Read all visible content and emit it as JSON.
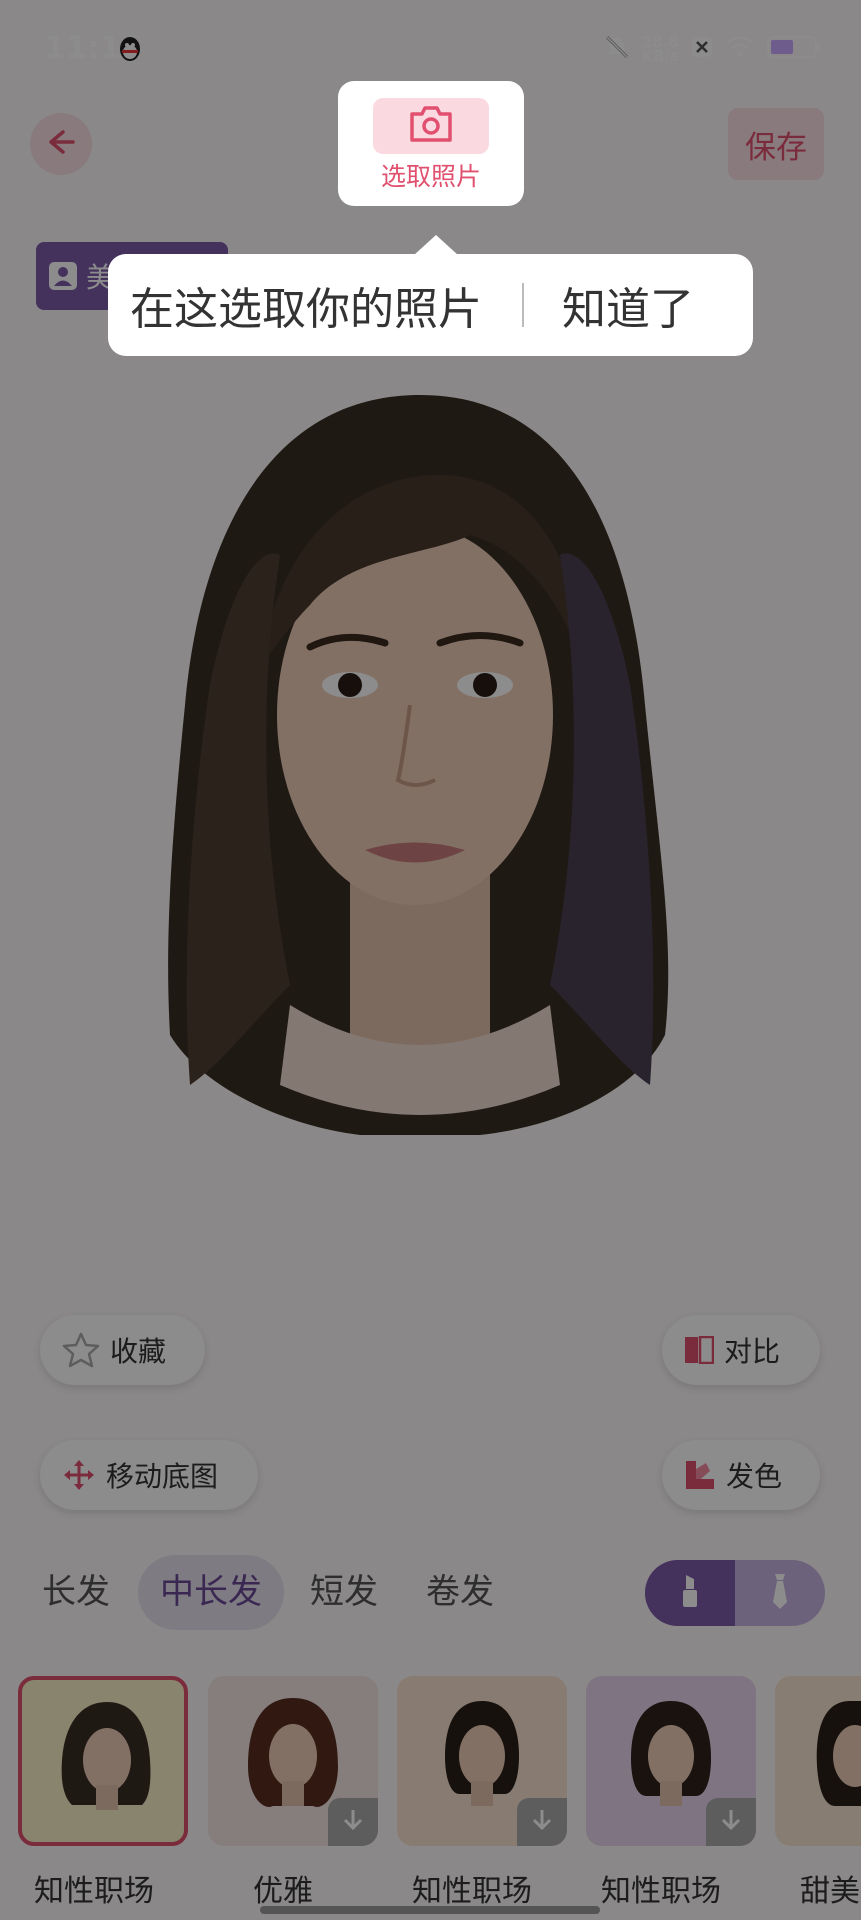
{
  "status_bar": {
    "time": "11:11",
    "net_speed_value": "28.8",
    "net_speed_unit": "KB/s"
  },
  "header": {
    "save_label": "保存"
  },
  "photo_picker": {
    "label": "选取照片"
  },
  "guide_tip": {
    "message": "在这选取你的照片",
    "dismiss_label": "知道了"
  },
  "model_tag": {
    "label": "美"
  },
  "actions": {
    "favorite_label": "收藏",
    "compare_label": "对比",
    "move_bg_label": "移动底图",
    "hair_color_label": "发色"
  },
  "tabs": [
    {
      "label": "长发",
      "active": false
    },
    {
      "label": "中长发",
      "active": true
    },
    {
      "label": "短发",
      "active": false
    },
    {
      "label": "卷发",
      "active": false
    }
  ],
  "styles": [
    {
      "label": "知性职场",
      "selected": true
    },
    {
      "label": "优雅",
      "selected": false
    },
    {
      "label": "知性职场",
      "selected": false
    },
    {
      "label": "知性职场",
      "selected": false
    },
    {
      "label": "甜美",
      "selected": false
    }
  ],
  "colors": {
    "accent": "#e1506e",
    "purple": "#7c5aa8"
  }
}
